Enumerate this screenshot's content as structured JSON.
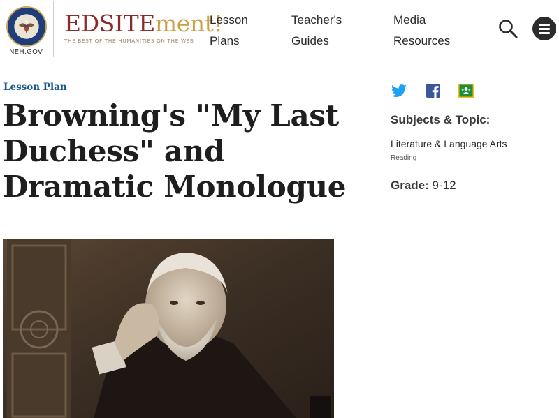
{
  "header": {
    "seal_alt": "National Endowment for the Humanities seal",
    "neh_label": "NEH.GOV",
    "brand_part1": "EDSITE",
    "brand_part2": "ment!",
    "brand_tagline": "THE BEST OF THE HUMANITIES ON THE WEB",
    "nav": [
      {
        "line1": "Lesson",
        "line2": "Plans"
      },
      {
        "line1": "Teacher's",
        "line2": "Guides"
      },
      {
        "line1": "Media",
        "line2": "Resources"
      }
    ],
    "search_icon": "search-icon",
    "menu_icon": "hamburger-menu-icon"
  },
  "main": {
    "kicker": "Lesson Plan",
    "title": "Browning's \"My Last Duchess\" and Dramatic Monologue",
    "image_icon": "portrait-photo"
  },
  "sidebar": {
    "share_icons": [
      "twitter-icon",
      "facebook-icon",
      "google-classroom-icon"
    ],
    "subjects_heading": "Subjects & Topic:",
    "subject": "Literature & Language Arts",
    "topic": "Reading",
    "grade_label": "Grade:",
    "grade_value": " 9-12"
  },
  "colors": {
    "brand_red": "#8a2a2a",
    "brand_gold": "#c8a048",
    "kicker_blue": "#1c5a8e",
    "twitter": "#1da1f2",
    "facebook": "#3b5998",
    "classroom": "#1e8e3e"
  }
}
